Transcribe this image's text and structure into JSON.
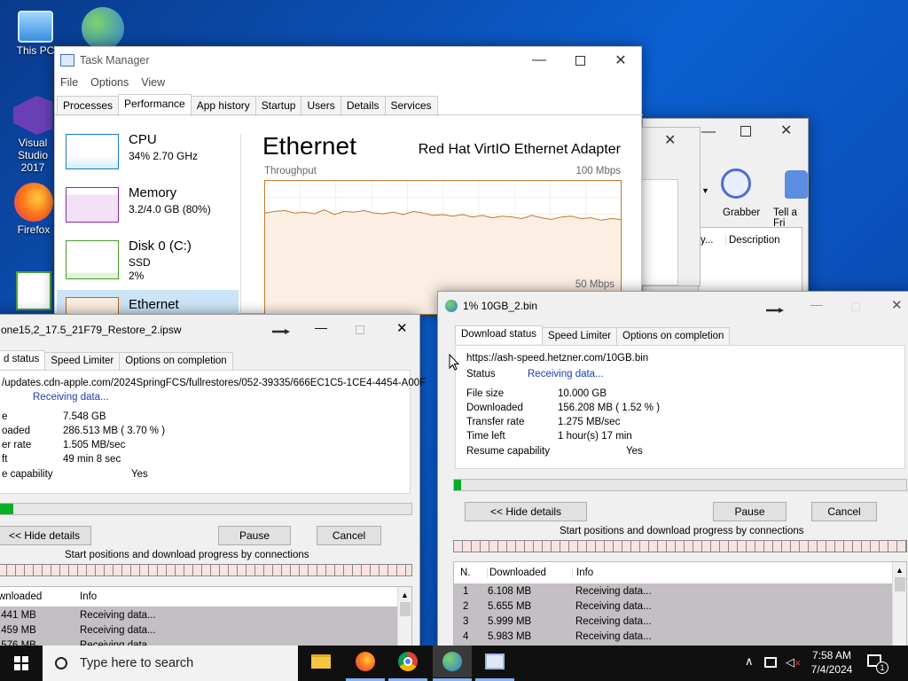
{
  "desktop": {
    "icons": [
      {
        "label": "This PC"
      },
      {
        "label": "Visual Studio 2017"
      },
      {
        "label": "Firefox"
      }
    ]
  },
  "taskmanager": {
    "title": "Task Manager",
    "menu": [
      "File",
      "Options",
      "View"
    ],
    "tabs": [
      "Processes",
      "Performance",
      "App history",
      "Startup",
      "Users",
      "Details",
      "Services"
    ],
    "sidebar": [
      {
        "name": "CPU",
        "sub": "34% 2.70 GHz"
      },
      {
        "name": "Memory",
        "sub": "3.2/4.0 GB (80%)"
      },
      {
        "name": "Disk 0 (C:)",
        "sub": "SSD",
        "sub2": "2%"
      },
      {
        "name": "Ethernet"
      }
    ],
    "heading": "Ethernet",
    "adapter": "Red Hat VirtIO Ethernet Adapter",
    "graph_label": "Throughput",
    "graph_max": "100 Mbps",
    "graph_mid": "50 Mbps",
    "throughput_series": [
      82,
      84,
      85,
      82,
      83,
      81,
      86,
      80,
      84,
      83,
      85,
      82,
      81,
      83,
      80,
      84,
      82,
      79,
      80,
      78,
      80,
      77,
      79,
      76,
      78,
      77,
      75,
      79,
      76,
      74,
      77,
      78,
      75,
      76,
      73,
      75,
      74
    ]
  },
  "idm_back": {
    "toolbar": [
      "Grabber",
      "Tell a Fri"
    ],
    "col_header": "Description",
    "col_left": "y..."
  },
  "dl_left": {
    "title": "one15,2_17.5_21F79_Restore_2.ipsw",
    "tabs": [
      "d status",
      "Speed Limiter",
      "Options on completion"
    ],
    "url": "/updates.cdn-apple.com/2024SpringFCS/fullrestores/052-39335/666EC1C5-1CE4-4454-A00F",
    "status": "Receiving data...",
    "fields": [
      {
        "label": "e",
        "value": "7.548  GB"
      },
      {
        "label": "oaded",
        "value": "286.513  MB  ( 3.70 % )"
      },
      {
        "label": "er rate",
        "value": "1.505  MB/sec"
      },
      {
        "label": "ft",
        "value": "49 min 8 sec"
      },
      {
        "label": "e capability",
        "value": "Yes"
      }
    ],
    "progress": 3.7,
    "hide_btn": "<< Hide details",
    "pause_btn": "Pause",
    "cancel_btn": "Cancel",
    "conn_caption": "Start positions and download progress by connections",
    "table_headers": [
      "wnloaded",
      "Info"
    ],
    "rows": [
      {
        "dl": ".441  MB",
        "info": "Receiving data..."
      },
      {
        "dl": ".459  MB",
        "info": "Receiving data..."
      },
      {
        "dl": ".576  MB",
        "info": "Receiving data..."
      }
    ]
  },
  "dl_right": {
    "title": "1% 10GB_2.bin",
    "tabs": [
      "Download status",
      "Speed Limiter",
      "Options on completion"
    ],
    "url": "https://ash-speed.hetzner.com/10GB.bin",
    "status_label": "Status",
    "status": "Receiving data...",
    "fields": [
      {
        "label": "File size",
        "value": "10.000  GB"
      },
      {
        "label": "Downloaded",
        "value": "156.208  MB  ( 1.52 % )"
      },
      {
        "label": "Transfer rate",
        "value": "1.275  MB/sec"
      },
      {
        "label": "Time left",
        "value": "1 hour(s) 17 min"
      },
      {
        "label": "Resume capability",
        "value": "Yes"
      }
    ],
    "progress": 1.52,
    "hide_btn": "<< Hide details",
    "pause_btn": "Pause",
    "cancel_btn": "Cancel",
    "conn_caption": "Start positions and download progress by connections",
    "table_headers": [
      "N.",
      "Downloaded",
      "Info"
    ],
    "rows": [
      {
        "n": "1",
        "dl": "6.108  MB",
        "info": "Receiving data..."
      },
      {
        "n": "2",
        "dl": "5.655  MB",
        "info": "Receiving data..."
      },
      {
        "n": "3",
        "dl": "5.999  MB",
        "info": "Receiving data..."
      },
      {
        "n": "4",
        "dl": "5.983  MB",
        "info": "Receiving data..."
      }
    ]
  },
  "taskbar": {
    "search_placeholder": "Type here to search",
    "time": "7:58 AM",
    "date": "7/4/2024",
    "notif_count": "1"
  }
}
